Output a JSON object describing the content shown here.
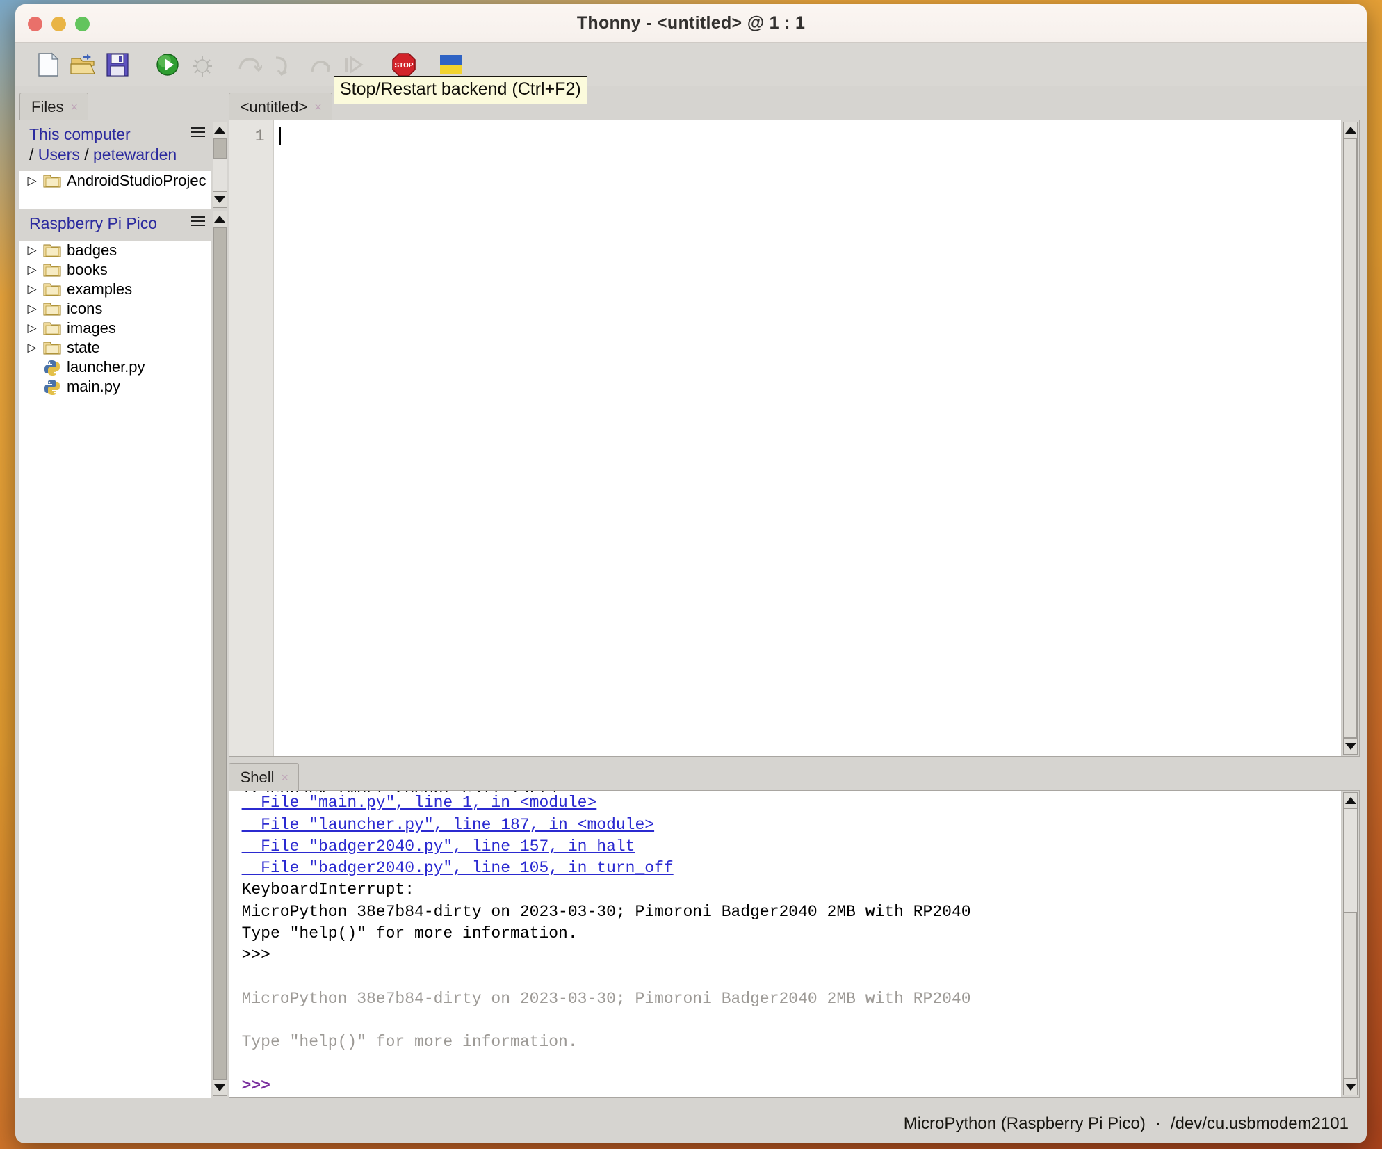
{
  "window": {
    "title": "Thonny  -  <untitled> @ 1 : 1",
    "traffic": {
      "close": "close-button",
      "minimize": "minimize-button",
      "zoom": "zoom-button"
    }
  },
  "toolbar": {
    "buttons": [
      {
        "name": "new-file",
        "icon": "new-file-icon",
        "enabled": true
      },
      {
        "name": "open-file",
        "icon": "open-folder-icon",
        "enabled": true
      },
      {
        "name": "save-file",
        "icon": "save-floppy-icon",
        "enabled": true
      },
      {
        "name": "run-script",
        "icon": "run-play-icon",
        "enabled": true
      },
      {
        "name": "debug-script",
        "icon": "debug-bug-icon",
        "enabled": false
      },
      {
        "name": "step-over",
        "icon": "step-over-icon",
        "enabled": false
      },
      {
        "name": "step-into",
        "icon": "step-into-icon",
        "enabled": false
      },
      {
        "name": "step-out",
        "icon": "step-out-icon",
        "enabled": false
      },
      {
        "name": "resume",
        "icon": "resume-icon",
        "enabled": false
      },
      {
        "name": "stop-restart-backend",
        "icon": "stop-sign-icon",
        "enabled": true
      },
      {
        "name": "support-ukraine",
        "icon": "ukraine-flag-icon",
        "enabled": true
      }
    ]
  },
  "tooltip": {
    "text": "Stop/Restart backend (Ctrl+F2)"
  },
  "files_panel": {
    "tab_label": "Files",
    "tab_close": "×",
    "local": {
      "title": "This computer",
      "path_sep": "/",
      "path_parts": [
        "Users",
        "petewarden"
      ],
      "items": [
        {
          "label": "AndroidStudioProjec",
          "type": "folder",
          "expandable": true
        }
      ]
    },
    "device": {
      "title": "Raspberry Pi Pico",
      "items": [
        {
          "label": "badges",
          "type": "folder",
          "expandable": true
        },
        {
          "label": "books",
          "type": "folder",
          "expandable": true
        },
        {
          "label": "examples",
          "type": "folder",
          "expandable": true
        },
        {
          "label": "icons",
          "type": "folder",
          "expandable": true
        },
        {
          "label": "images",
          "type": "folder",
          "expandable": true
        },
        {
          "label": "state",
          "type": "folder",
          "expandable": true
        },
        {
          "label": "launcher.py",
          "type": "python",
          "expandable": false
        },
        {
          "label": "main.py",
          "type": "python",
          "expandable": false
        }
      ]
    }
  },
  "editor": {
    "tab_label": "<untitled>",
    "tab_close": "×",
    "line_numbers": [
      "1"
    ],
    "content": ""
  },
  "shell": {
    "tab_label": "Shell",
    "tab_close": "×",
    "lines": [
      {
        "text": "Traceback (most recent call last):",
        "style": "clipped"
      },
      {
        "text": "  File \"main.py\", line 1, in <module>",
        "style": "link"
      },
      {
        "text": "  File \"launcher.py\", line 187, in <module>",
        "style": "link"
      },
      {
        "text": "  File \"badger2040.py\", line 157, in halt",
        "style": "link"
      },
      {
        "text": "  File \"badger2040.py\", line 105, in turn_off",
        "style": "link"
      },
      {
        "text": "KeyboardInterrupt:",
        "style": "plain"
      },
      {
        "text": "MicroPython 38e7b84-dirty on 2023-03-30; Pimoroni Badger2040 2MB with RP2040",
        "style": "plain"
      },
      {
        "text": "Type \"help()\" for more information.",
        "style": "plain"
      },
      {
        "text": ">>> ",
        "style": "plain"
      },
      {
        "text": "",
        "style": "plain"
      },
      {
        "text": "MicroPython 38e7b84-dirty on 2023-03-30; Pimoroni Badger2040 2MB with RP2040",
        "style": "dim"
      },
      {
        "text": "",
        "style": "plain"
      },
      {
        "text": "Type \"help()\" for more information.",
        "style": "dim"
      },
      {
        "text": "",
        "style": "plain"
      },
      {
        "text": ">>>",
        "style": "prompt-purple"
      }
    ]
  },
  "statusbar": {
    "interpreter": "MicroPython (Raspberry Pi Pico)",
    "separator": "·",
    "port": "/dev/cu.usbmodem2101"
  },
  "colors": {
    "desktop": "#d8892c",
    "window_bg": "#d6d4d0",
    "titlebar": "#f8f3ef",
    "link_blue": "#2b2ad0",
    "path_blue": "#2b2a9e",
    "prompt_purple": "#7a2f9e",
    "tooltip_bg": "#fcfbdc",
    "dim_text": "#9d9a96"
  }
}
